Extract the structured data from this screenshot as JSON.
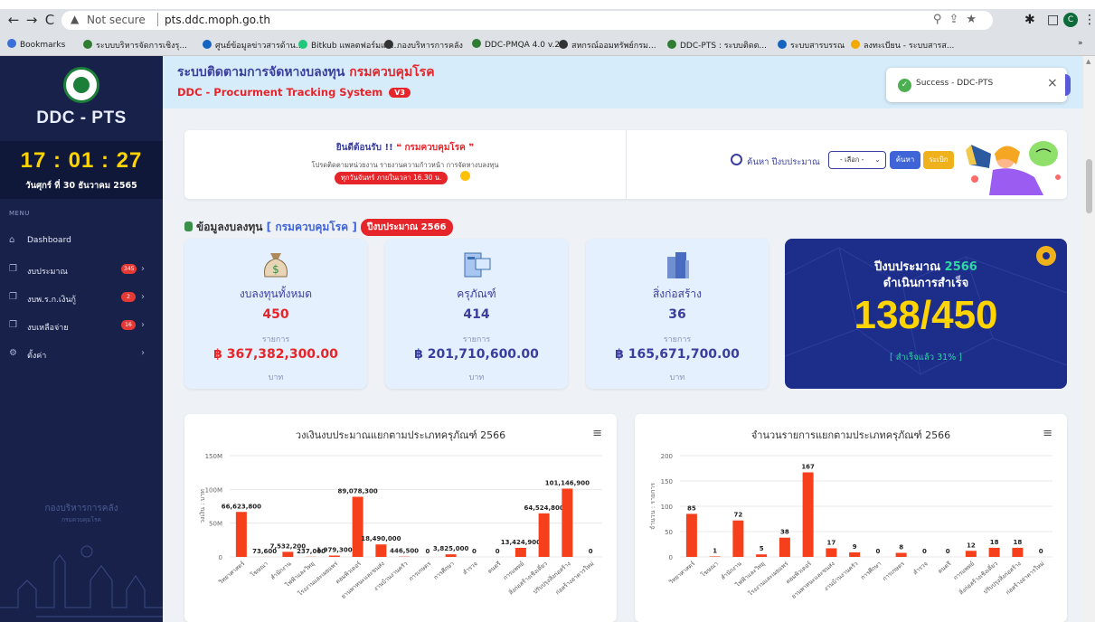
{
  "browser": {
    "security_label": "Not secure",
    "url": "pts.ddc.moph.go.th",
    "profile_initial": "C",
    "bookmarks": [
      {
        "label": "Bookmarks",
        "color": "#3b6fd8"
      },
      {
        "label": "ระบบบริหารจัดการเชิงรุ...",
        "color": "#2e7d32"
      },
      {
        "label": "ศูนย์ข้อมูลข่าวสารด้าน...",
        "color": "#1565c0"
      },
      {
        "label": "Bitkub แพลตฟอร์มแห...",
        "color": "#21c77a"
      },
      {
        "label": "กองบริหารการคลัง",
        "color": "#333333"
      },
      {
        "label": "DDC-PMQA 4.0 v.2",
        "color": "#2e7d32"
      },
      {
        "label": "สหกรณ์ออมทรัพย์กรม...",
        "color": "#333333"
      },
      {
        "label": "DDC-PTS : ระบบติดต...",
        "color": "#2e7d32"
      },
      {
        "label": "ระบบสารบรรณ",
        "color": "#1565c0"
      },
      {
        "label": "ลงทะเบียน - ระบบสารส...",
        "color": "#f2a900"
      }
    ]
  },
  "sidebar": {
    "brand": "DDC - PTS",
    "clock": "17 : 01 : 27",
    "date": "วันศุกร์ ที่ 30 ธันวาคม 2565",
    "menu_label": "MENU",
    "items": [
      {
        "label": "Dashboard",
        "icon": "home-icon",
        "badge": ""
      },
      {
        "label": "งบประมาณ",
        "icon": "cube-icon",
        "badge": "345"
      },
      {
        "label": "งบพ.ร.ก.เงินกู้",
        "icon": "cube-icon",
        "badge": "2"
      },
      {
        "label": "งบเหลือจ่าย",
        "icon": "cube-icon",
        "badge": "16"
      },
      {
        "label": "ตั้งค่า",
        "icon": "gear-icon",
        "badge": ""
      }
    ],
    "footer": "กองบริหารการคลัง",
    "footer_sub": "กรมควบคุมโรค"
  },
  "header": {
    "title_prefix": "ระบบติดตามการจัดหางบลงทุน ",
    "title_org": "กรมควบคุมโรค",
    "subtitle": "DDC - Procurment Tracking System",
    "version": "V3",
    "toast": "Success - DDC-PTS"
  },
  "welcome": {
    "title_prefix": "ยินดีต้อนรับ !! ",
    "title_org": "❝ กรมควบคุมโรค ❞",
    "desc": "โปรดติดตามหน่วยงาน รายงานความก้าวหน้า การจัดหางบลงทุน",
    "pill": "ทุกวันจันทร์ ภายในเวลา 16.30 น.",
    "search_label": "ค้นหา ปีงบประมาณ",
    "select_value": "- เลือก -",
    "btn_search": "ค้นหา",
    "btn_all": "ระเบิก"
  },
  "section": {
    "title": "ข้อมูลงบลงทุน",
    "org": "[ กรมควบคุมโรค ]",
    "year_pill": "ปีงบประมาณ 2566"
  },
  "cards": [
    {
      "title": "งบลงทุนทั้งหมด",
      "count": "450",
      "count_unit": "รายการ",
      "amount": "฿ 367,382,300.00",
      "amount_unit": "บาท"
    },
    {
      "title": "ครุภัณฑ์",
      "count": "414",
      "count_unit": "รายการ",
      "amount": "฿ 201,710,600.00",
      "amount_unit": "บาท"
    },
    {
      "title": "สิ่งก่อสร้าง",
      "count": "36",
      "count_unit": "รายการ",
      "amount": "฿ 165,671,700.00",
      "amount_unit": "บาท"
    }
  ],
  "status": {
    "year_label": "ปีงบประมาณ",
    "year": "2566",
    "done_label": "ดำเนินการสำเร็จ",
    "ratio": "138/450",
    "percent": "[ สำเร็จแล้ว 31% ]"
  },
  "chart_data": [
    {
      "type": "bar",
      "title": "วงเงินงบประมาณแยกตามประเภทครุภัณฑ์ 2566",
      "ylabel": "วงเงิน : บาท",
      "ylim": [
        0,
        150000000
      ],
      "yticks": [
        "0",
        "50M",
        "100M",
        "150M"
      ],
      "categories": [
        "วิทยาศาสตร์",
        "โฆษณา",
        "สำนักงาน",
        "ไฟฟ้าและวิทยุ",
        "โรงงานและเผยแพร่",
        "คอมพิวเตอร์",
        "ยานพาหนะและขนส่ง",
        "งานบ้านงานครัว",
        "การเกษตร",
        "การศึกษา",
        "สำรวจ",
        "ดนตรี",
        "การแพทย์",
        "สิ่งก่อสร้างเชิงเดี่ยว",
        "ปรับปรุงสิ่งก่อสร้าง",
        "ก่อสร้างอาคารใหม่"
      ],
      "values": [
        66623800,
        73600,
        7532200,
        237000,
        1979300,
        89078300,
        18490000,
        446500,
        0,
        3825000,
        0,
        0,
        13424900,
        64524800,
        101146900,
        0
      ],
      "labels": [
        "66,623,800",
        "73,600",
        "7,532,200",
        "237,000",
        "1,979,300",
        "89,078,300",
        "18,490,000",
        "446,500",
        "0",
        "3,825,000",
        "0",
        "0",
        "13,424,900",
        "64,524,800",
        "101,146,900",
        "0"
      ],
      "color": "#f5401b"
    },
    {
      "type": "bar",
      "title": "จำนวนรายการแยกตามประเภทครุภัณฑ์ 2566",
      "ylabel": "จำนวน : รายการ",
      "ylim": [
        0,
        200
      ],
      "yticks": [
        "0",
        "50",
        "100",
        "150",
        "200"
      ],
      "categories": [
        "วิทยาศาสตร์",
        "โฆษณา",
        "สำนักงาน",
        "ไฟฟ้าและวิทยุ",
        "โรงงานและเผยแพร่",
        "คอมพิวเตอร์",
        "ยานพาหนะและขนส่ง",
        "งานบ้านงานครัว",
        "การศึกษา",
        "การเกษตร",
        "สำรวจ",
        "ดนตรี",
        "การแพทย์",
        "สิ่งก่อสร้างเชิงเดี่ยว",
        "ปรับปรุงสิ่งก่อสร้าง",
        "ก่อสร้างอาคารใหม่"
      ],
      "values": [
        85,
        1,
        72,
        5,
        38,
        167,
        17,
        9,
        0,
        8,
        0,
        0,
        12,
        18,
        18,
        0
      ],
      "labels": [
        "85",
        "1",
        "72",
        "5",
        "38",
        "167",
        "17",
        "9",
        "0",
        "8",
        "0",
        "0",
        "12",
        "18",
        "18",
        "0"
      ],
      "color": "#f5401b"
    }
  ]
}
